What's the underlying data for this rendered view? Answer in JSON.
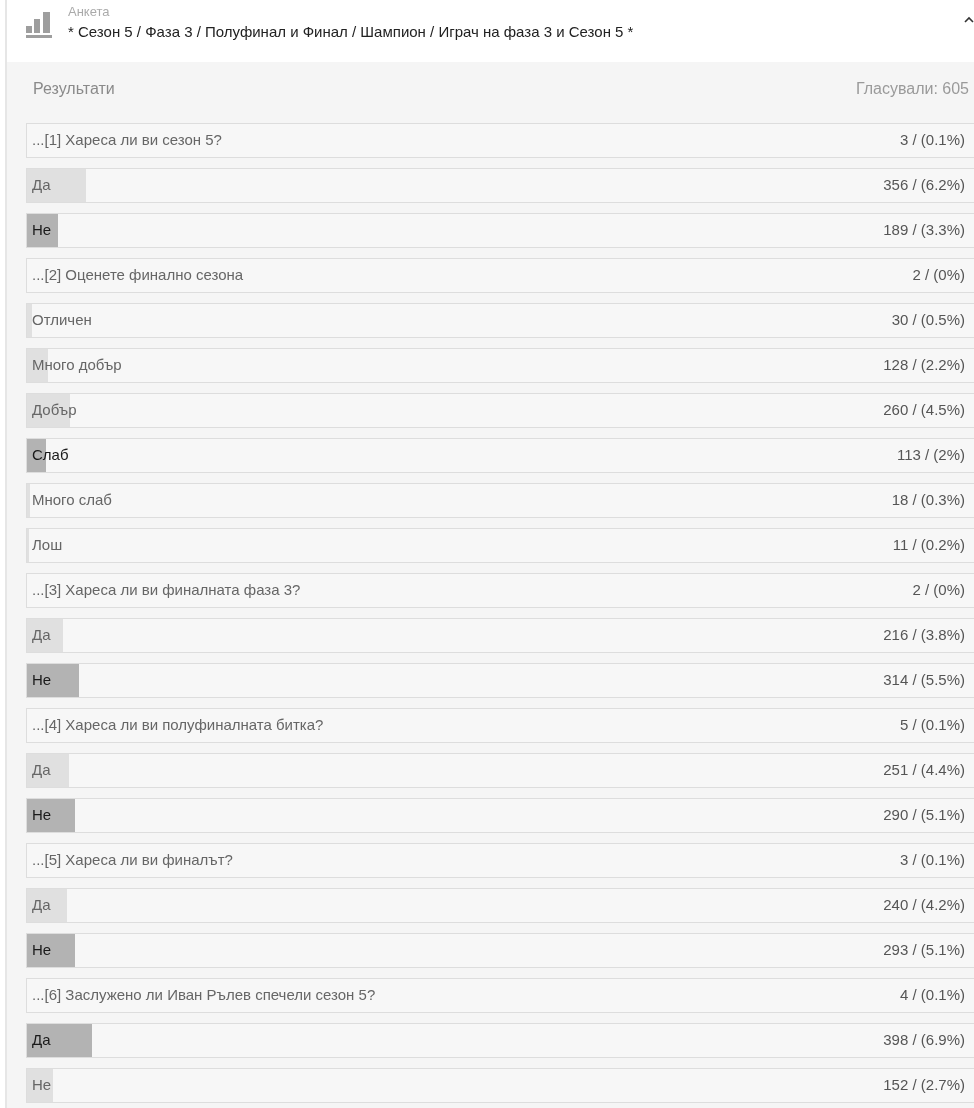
{
  "header": {
    "label": "Анкета",
    "title": "* Сезон 5 / Фаза 3 / Полуфинал и Финал / Шампион / Играч на фаза 3 и Сезон 5 *"
  },
  "results": {
    "title": "Результати",
    "votes": "Гласували: 605"
  },
  "questions": [
    {
      "text": "...[1] Хареса ли ви сезон 5?",
      "count": "3 / (0.1%)",
      "answers": [
        {
          "label": "Да",
          "count": "356 / (6.2%)",
          "level": 0.062,
          "selected": false
        },
        {
          "label": "Не",
          "count": "189 / (3.3%)",
          "level": 0.033,
          "selected": true
        }
      ]
    },
    {
      "text": "...[2] Оценете финално сезона",
      "count": "2 / (0%)",
      "answers": [
        {
          "label": "Отличен",
          "count": "30 / (0.5%)",
          "level": 0.005,
          "selected": false
        },
        {
          "label": "Много добър",
          "count": "128 / (2.2%)",
          "level": 0.022,
          "selected": false
        },
        {
          "label": "Добър",
          "count": "260 / (4.5%)",
          "level": 0.045,
          "selected": false
        },
        {
          "label": "Слаб",
          "count": "113 / (2%)",
          "level": 0.02,
          "selected": true
        },
        {
          "label": "Много слаб",
          "count": "18 / (0.3%)",
          "level": 0.003,
          "selected": false
        },
        {
          "label": "Лош",
          "count": "11 / (0.2%)",
          "level": 0.002,
          "selected": false
        }
      ]
    },
    {
      "text": "...[3] Хареса ли ви финалната фаза 3?",
      "count": "2 / (0%)",
      "answers": [
        {
          "label": "Да",
          "count": "216 / (3.8%)",
          "level": 0.038,
          "selected": false
        },
        {
          "label": "Не",
          "count": "314 / (5.5%)",
          "level": 0.055,
          "selected": true
        }
      ]
    },
    {
      "text": "...[4] Хареса ли ви полуфиналната битка?",
      "count": "5 / (0.1%)",
      "answers": [
        {
          "label": "Да",
          "count": "251 / (4.4%)",
          "level": 0.044,
          "selected": false
        },
        {
          "label": "Не",
          "count": "290 / (5.1%)",
          "level": 0.051,
          "selected": true
        }
      ]
    },
    {
      "text": "...[5] Хареса ли ви финалът?",
      "count": "3 / (0.1%)",
      "answers": [
        {
          "label": "Да",
          "count": "240 / (4.2%)",
          "level": 0.042,
          "selected": false
        },
        {
          "label": "Не",
          "count": "293 / (5.1%)",
          "level": 0.051,
          "selected": true
        }
      ]
    },
    {
      "text": "...[6] Заслужено ли Иван Рълев спечели сезон 5?",
      "count": "4 / (0.1%)",
      "answers": [
        {
          "label": "Да",
          "count": "398 / (6.9%)",
          "level": 0.069,
          "selected": true
        },
        {
          "label": "Не",
          "count": "152 / (2.7%)",
          "level": 0.027,
          "selected": false
        }
      ]
    }
  ]
}
